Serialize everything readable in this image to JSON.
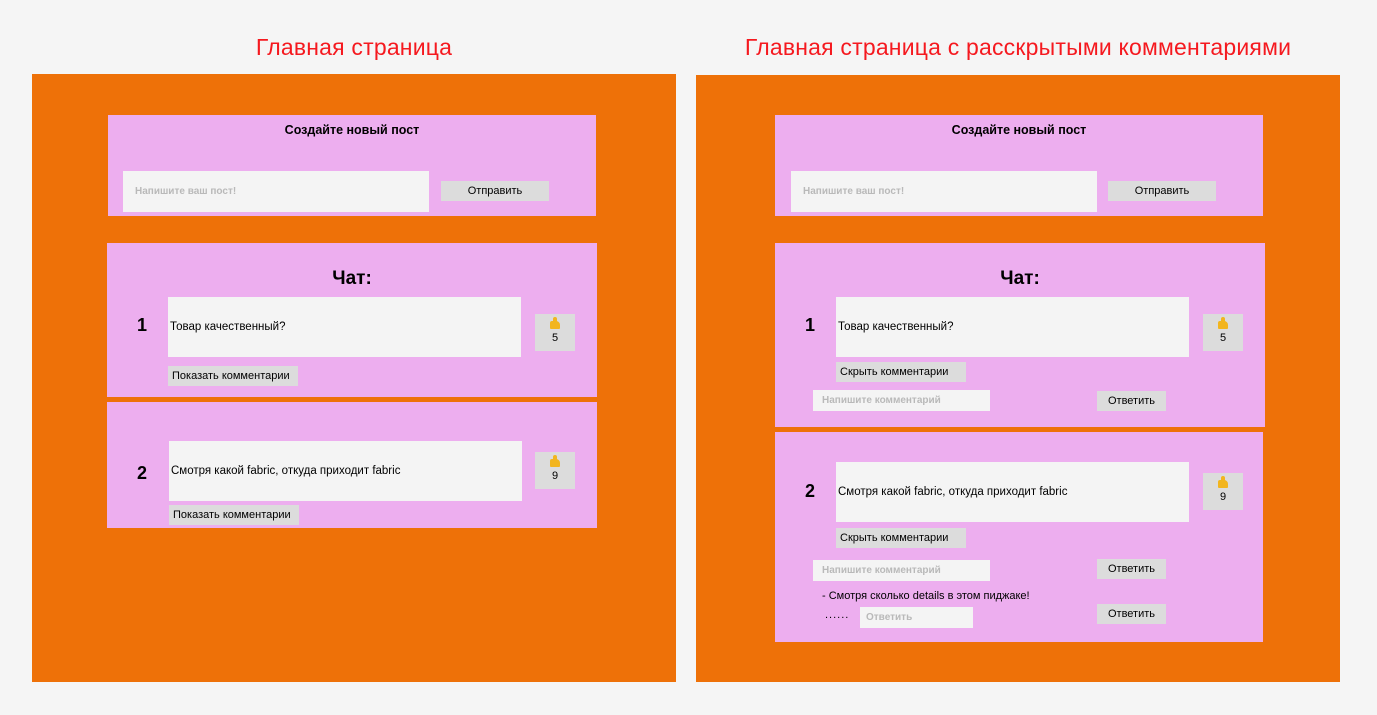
{
  "frames": {
    "main": {
      "title": "Главная страница",
      "create": {
        "heading": "Создайте новый пост",
        "placeholder": "Напишите ваш пост!",
        "send_label": "Отправить"
      },
      "chat_title": "Чат:",
      "posts": [
        {
          "number": "1",
          "text": "Товар качественный?",
          "likes": "5",
          "toggle_label": "Показать комментарии"
        },
        {
          "number": "2",
          "text": "Смотря какой fabric, откуда приходит fabric",
          "likes": "9",
          "toggle_label": "Показать комментарии"
        }
      ]
    },
    "expanded": {
      "title": "Главная страница с расскрытыми комментариями",
      "create": {
        "heading": "Создайте новый пост",
        "placeholder": "Напишите ваш пост!",
        "send_label": "Отправить"
      },
      "chat_title": "Чат:",
      "posts": [
        {
          "number": "1",
          "text": "Товар качественный?",
          "likes": "5",
          "toggle_label": "Скрыть комментарии",
          "comment_placeholder": "Напишите комментарий",
          "reply_label": "Ответить"
        },
        {
          "number": "2",
          "text": "Смотря какой fabric, откуда приходит fabric",
          "likes": "9",
          "toggle_label": "Скрыть комментарии",
          "comment_placeholder": "Напишите комментарий",
          "reply_label": "Ответить",
          "comments": [
            {
              "text": "- Смотря сколько details в этом пиджаке!",
              "reply_label": "Ответить",
              "dots": "......",
              "reply_placeholder": "Ответить"
            }
          ]
        }
      ]
    }
  },
  "colors": {
    "frame_bg": "#ee7108",
    "panel_bg": "#edaeef",
    "title_red": "#f5191f",
    "field_bg": "#f4f4f4",
    "button_bg": "#dcdcdc"
  },
  "icons": {
    "like": "thumbs-up-icon"
  }
}
